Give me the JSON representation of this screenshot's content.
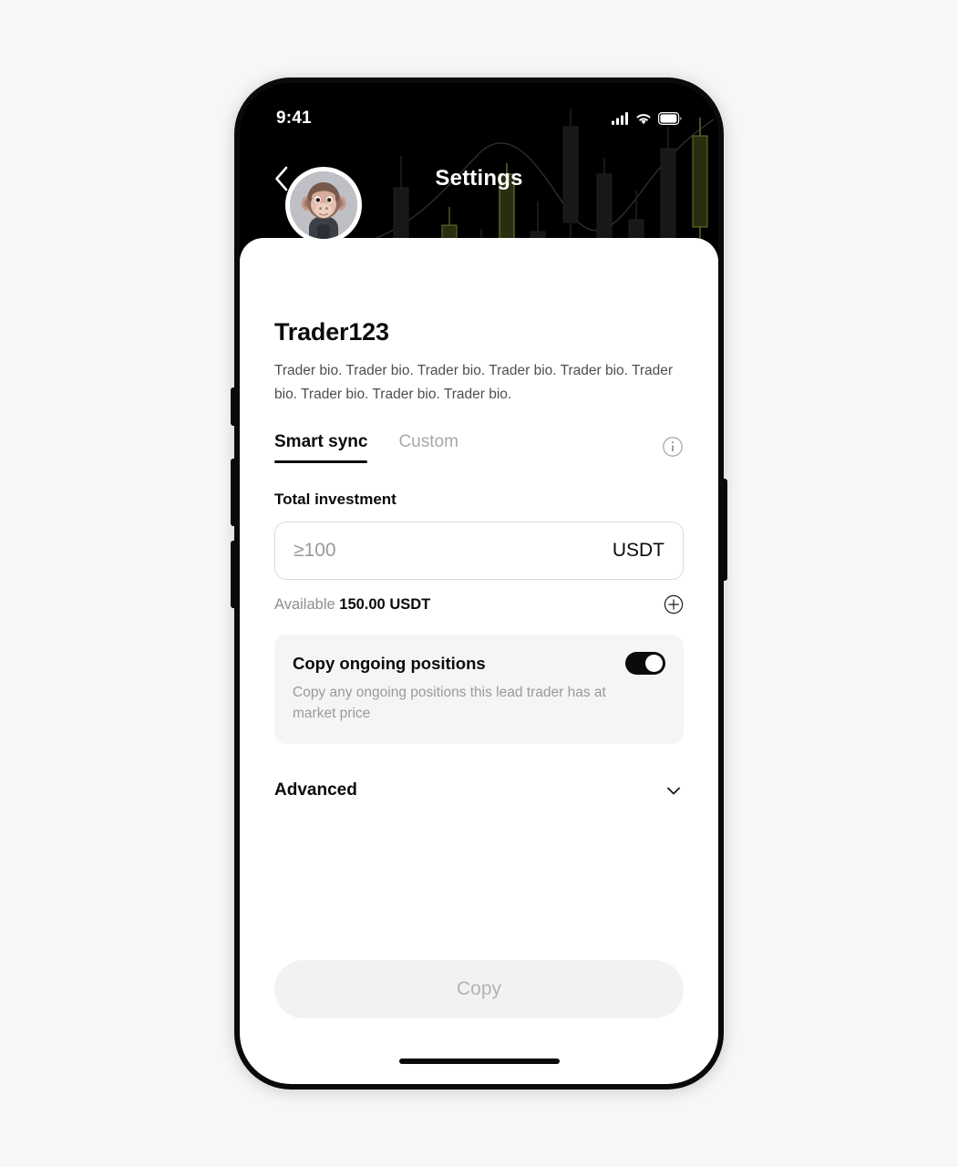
{
  "statusbar": {
    "time": "9:41",
    "cellular_icon": "cellular-signal-icon",
    "wifi_icon": "wifi-icon",
    "battery_icon": "battery-icon"
  },
  "header": {
    "title": "Settings",
    "back_icon": "chevron-left-icon",
    "background": "candlestick-chart-backdrop"
  },
  "profile": {
    "avatar_icon": "ape-avatar",
    "username": "Trader123",
    "bio": "Trader bio. Trader bio. Trader bio. Trader bio. Trader bio. Trader bio. Trader bio. Trader bio. Trader bio."
  },
  "tabs": {
    "items": [
      {
        "label": "Smart sync",
        "active": true
      },
      {
        "label": "Custom",
        "active": false
      }
    ],
    "info_icon": "info-circle-icon"
  },
  "investment": {
    "label": "Total investment",
    "placeholder": "≥100",
    "value": "",
    "unit": "USDT",
    "available_label": "Available",
    "available_value": "150.00 USDT",
    "add_icon": "plus-circle-icon"
  },
  "copy_positions": {
    "title": "Copy ongoing positions",
    "description": "Copy any ongoing positions this lead trader has at market price",
    "toggle_state": "on",
    "toggle_icon": "toggle-switch-icon"
  },
  "advanced": {
    "label": "Advanced",
    "chevron_icon": "chevron-down-icon",
    "expanded": false
  },
  "cta": {
    "label": "Copy",
    "disabled": true
  },
  "colors": {
    "frame": "#0a0a0a",
    "sheet": "#ffffff",
    "accent": "#0b0b0b",
    "muted": "#9a9a9a",
    "card": "#f5f5f5",
    "cta_bg": "#f2f2f2",
    "cta_text": "#b3b3b3",
    "candle_green": "#9aa83a",
    "page_bg": "#f7f7f7"
  }
}
